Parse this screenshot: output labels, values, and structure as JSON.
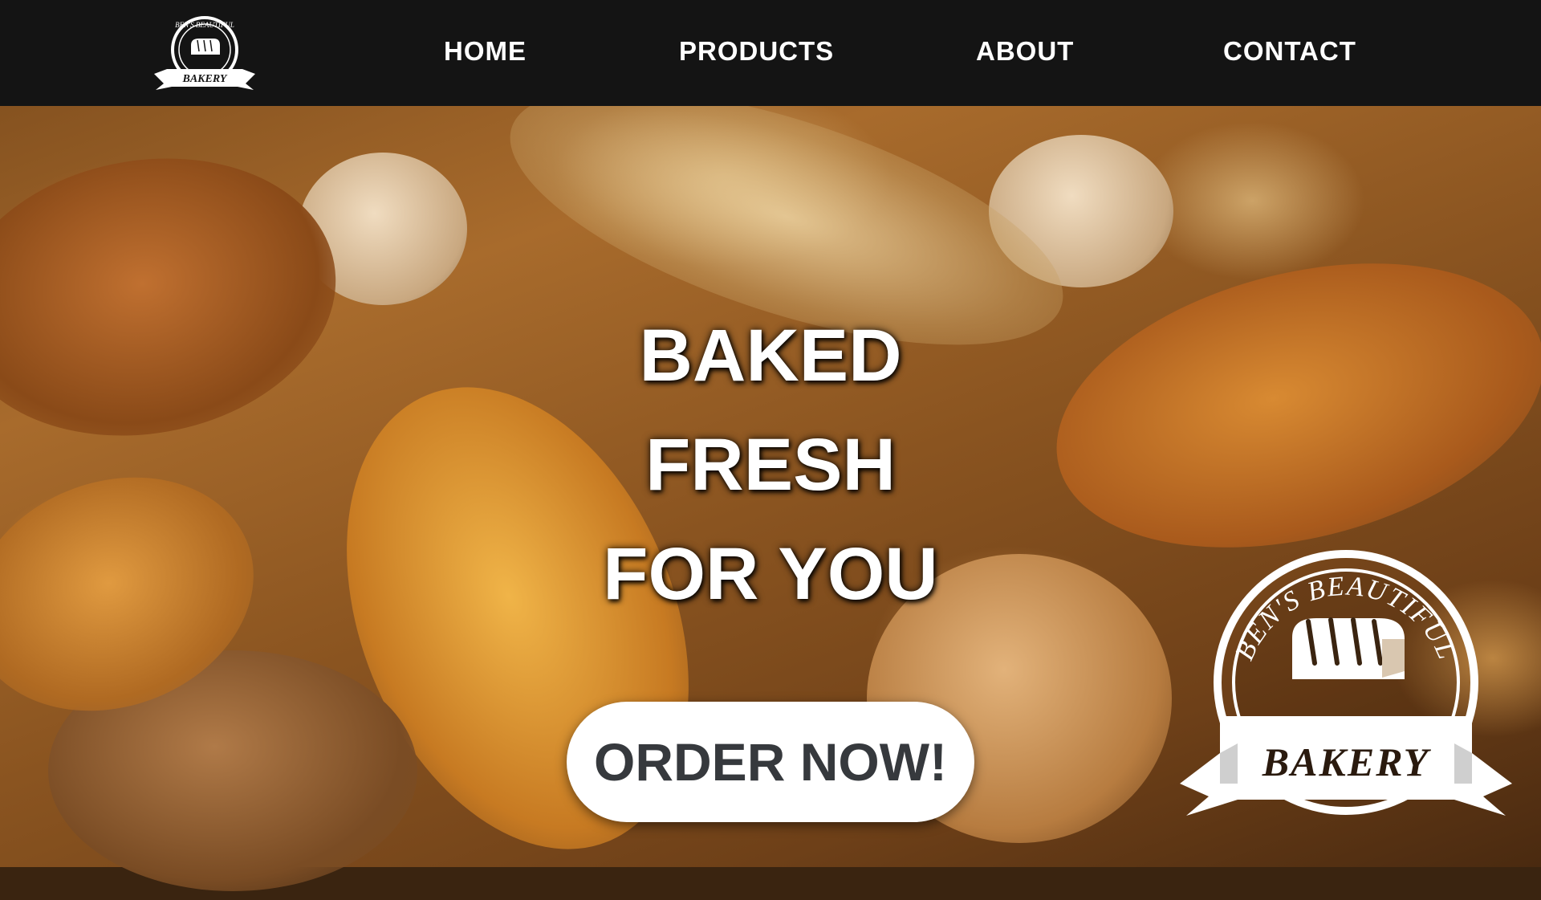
{
  "brand": {
    "logo_top_text": "BEN'S BEAUTIFUL",
    "logo_bottom_text": "BAKERY"
  },
  "nav": {
    "items": [
      {
        "label": "HOME"
      },
      {
        "label": "PRODUCTS"
      },
      {
        "label": "ABOUT"
      },
      {
        "label": "CONTACT"
      }
    ]
  },
  "hero": {
    "headline_lines": [
      "BAKED",
      "FRESH",
      "FOR YOU"
    ],
    "cta_label": "ORDER NOW!",
    "background_image": "bread-pastries-wheat-photo"
  },
  "colors": {
    "navbar_bg": "#141414",
    "nav_text": "#ffffff",
    "headline_text": "#ffffff",
    "button_bg": "#ffffff",
    "button_text": "#36393d"
  }
}
